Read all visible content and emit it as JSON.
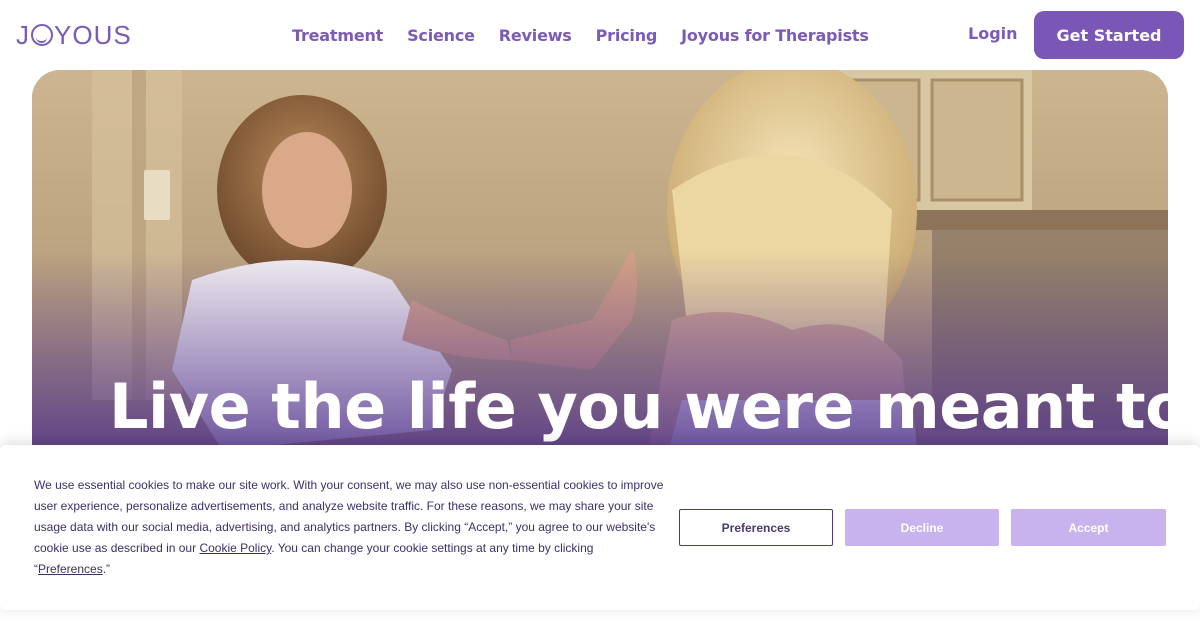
{
  "header": {
    "logo_text": "JOYOUS",
    "nav": [
      "Treatment",
      "Science",
      "Reviews",
      "Pricing",
      "Joyous for Therapists"
    ],
    "login_label": "Login",
    "cta_label": "Get Started"
  },
  "hero": {
    "headline": "Live the life you were meant to"
  },
  "cookie_banner": {
    "text_part1": "We use essential cookies to make our site work. With your consent, we may also use non-essential cookies to improve user experience, personalize advertisements, and analyze website traffic. For these reasons, we may share your site usage data with our social media, advertising, and analytics partners. By clicking “Accept,” you agree to our website's cookie use as described in our ",
    "cookie_policy_link": "Cookie Policy",
    "text_part2": ". You can change your cookie settings at any time by clicking “",
    "preferences_link": "Preferences",
    "text_part3": ".”",
    "preferences_button": "Preferences",
    "decline_button": "Decline",
    "accept_button": "Accept"
  },
  "colors": {
    "brand_purple": "#7a57b6",
    "button_disabled_purple": "#c9b3ef",
    "cookie_text": "#3f2f66"
  }
}
